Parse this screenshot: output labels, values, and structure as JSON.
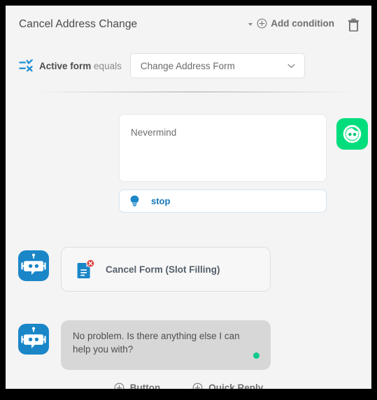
{
  "header": {
    "node_title": "Cancel Address Change",
    "add_condition_label": "Add condition",
    "caret_icon": "caret-down-icon",
    "add_icon": "circle-plus-icon",
    "delete_icon": "trash-icon"
  },
  "condition": {
    "icon": "condition-filter-icon",
    "field_label": "Active form",
    "operator_label": "equals",
    "select": {
      "value": "Change Address Form",
      "chevron_icon": "chevron-down-icon"
    }
  },
  "user_message": {
    "text": "Nevermind",
    "avatar_icon": "user-face-avatar-icon",
    "intent": {
      "icon": "lightbulb-icon",
      "label": "stop"
    }
  },
  "bot_action": {
    "avatar_icon": "bot-robot-avatar-icon",
    "icon": "document-cancel-icon",
    "label": "Cancel Form (Slot Filling)"
  },
  "bot_message": {
    "avatar_icon": "bot-robot-avatar-icon",
    "text": "No problem. Is there anything else I can help you with?",
    "status_dot": "online-status-dot"
  },
  "footer": {
    "buttons": [
      {
        "label": "Button",
        "icon": "circle-plus-icon"
      },
      {
        "label": "Quick Reply",
        "icon": "circle-plus-icon"
      }
    ]
  },
  "colors": {
    "accent_blue": "#1478bb",
    "bot_avatar_blue": "#1a86c8",
    "user_avatar_green": "#00dd7d",
    "status_green": "#10c98f",
    "error_red": "#e03a3a",
    "panel_bg": "#f4f4f4",
    "bubble_gray": "#d7d7d7"
  }
}
